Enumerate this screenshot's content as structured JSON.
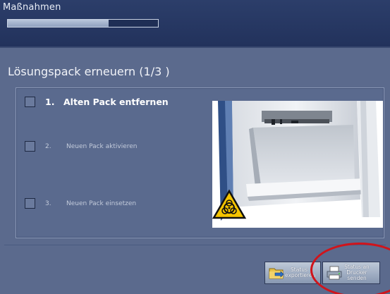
{
  "header": {
    "title": "Maßnahmen",
    "progress_fraction": 0.67
  },
  "page": {
    "title": "Lösungspack erneuern (1/3 )"
  },
  "steps": [
    {
      "number": "1.",
      "label": "Alten Pack entfernen",
      "active": true
    },
    {
      "number": "2.",
      "label": "Neuen Pack aktivieren",
      "active": false
    },
    {
      "number": "3.",
      "label": "Neuen Pack einsetzen",
      "active": false
    }
  ],
  "footer": {
    "export_button": {
      "line1": "Status",
      "line2": "exportieren"
    },
    "print_button": {
      "line1": "Status an",
      "line2": "Drucker",
      "line3": "senden"
    }
  },
  "colors": {
    "header_bg": "#22325c",
    "panel_bg": "#5a6a8e",
    "annotation_circle": "#d0141b",
    "biohazard_yellow": "#f5c400"
  }
}
